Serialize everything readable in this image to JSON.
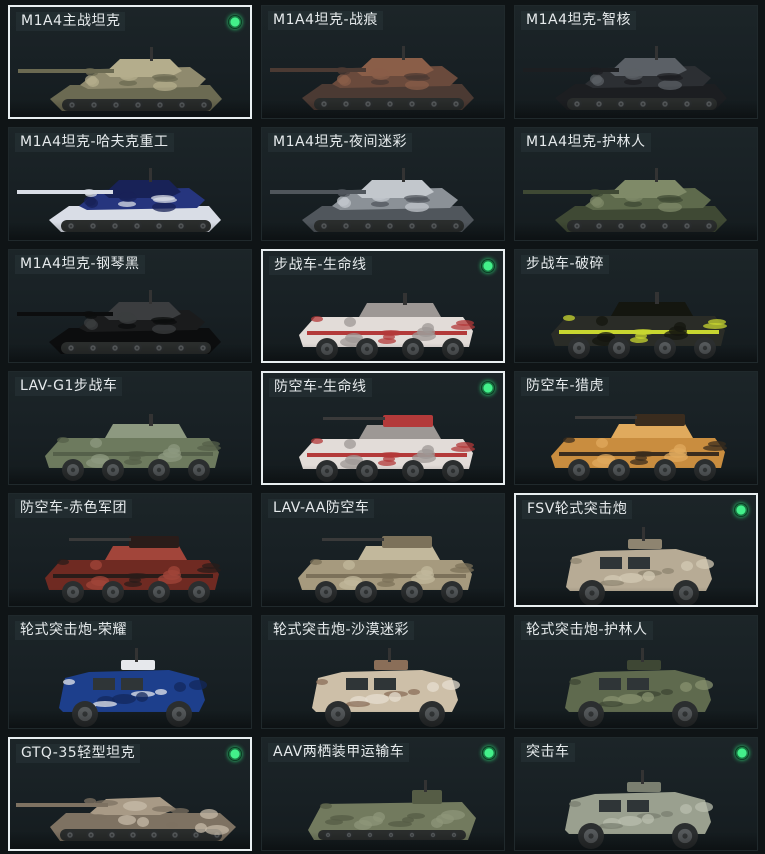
{
  "tiles": [
    {
      "label": "M1A4主战坦克",
      "owned": true,
      "selected": true,
      "kind": "tank",
      "colors": [
        "#8f8a6e",
        "#6b6a52",
        "#b4ad8c"
      ]
    },
    {
      "label": "M1A4坦克-战痕",
      "owned": false,
      "selected": false,
      "kind": "tank",
      "colors": [
        "#6a4a3c",
        "#4b3a33",
        "#8a5e48"
      ]
    },
    {
      "label": "M1A4坦克-智核",
      "owned": false,
      "selected": false,
      "kind": "tank",
      "colors": [
        "#2c2f33",
        "#1c1e21",
        "#5b6066"
      ]
    },
    {
      "label": "M1A4坦克-哈夫克重工",
      "owned": false,
      "selected": false,
      "kind": "tank",
      "colors": [
        "#26357e",
        "#d9dde6",
        "#182257"
      ]
    },
    {
      "label": "M1A4坦克-夜间迷彩",
      "owned": false,
      "selected": false,
      "kind": "tank",
      "colors": [
        "#8b9197",
        "#50565c",
        "#c2c7cc"
      ]
    },
    {
      "label": "M1A4坦克-护林人",
      "owned": false,
      "selected": false,
      "kind": "tank",
      "colors": [
        "#5e6a4c",
        "#3f4934",
        "#7f8a68"
      ]
    },
    {
      "label": "M1A4坦克-钢琴黑",
      "owned": false,
      "selected": false,
      "kind": "tank",
      "colors": [
        "#1a1b1c",
        "#0c0d0e",
        "#3b3d3f"
      ]
    },
    {
      "label": "步战车-生命线",
      "owned": true,
      "selected": true,
      "kind": "apc",
      "colors": [
        "#e2dcd8",
        "#b33a3a",
        "#9d9895"
      ]
    },
    {
      "label": "步战车-破碎",
      "owned": false,
      "selected": false,
      "kind": "apc",
      "colors": [
        "#2a2c27",
        "#c8d630",
        "#14160f"
      ]
    },
    {
      "label": "LAV-G1步战车",
      "owned": false,
      "selected": false,
      "kind": "apc",
      "colors": [
        "#6d7a5e",
        "#55604a",
        "#8d9980"
      ]
    },
    {
      "label": "防空车-生命线",
      "owned": true,
      "selected": true,
      "kind": "aa",
      "colors": [
        "#e2dcd8",
        "#b33a3a",
        "#9d9895"
      ]
    },
    {
      "label": "防空车-猎虎",
      "owned": false,
      "selected": false,
      "kind": "aa",
      "colors": [
        "#c98d3f",
        "#3a2c1e",
        "#e0aa5d"
      ]
    },
    {
      "label": "防空车-赤色军团",
      "owned": false,
      "selected": false,
      "kind": "aa",
      "colors": [
        "#6f2a22",
        "#2a1c19",
        "#a2453a"
      ]
    },
    {
      "label": "LAV-AA防空车",
      "owned": false,
      "selected": false,
      "kind": "aa",
      "colors": [
        "#a69a7e",
        "#7c715a",
        "#c2b89c"
      ]
    },
    {
      "label": "FSV轮式突击炮",
      "owned": true,
      "selected": true,
      "kind": "fsv",
      "colors": [
        "#b7ab95",
        "#8e8470",
        "#d3c9b4"
      ]
    },
    {
      "label": "轮式突击炮-荣耀",
      "owned": false,
      "selected": false,
      "kind": "fsv",
      "colors": [
        "#1d3f8c",
        "#e6e8ec",
        "#13285c"
      ]
    },
    {
      "label": "轮式突击炮-沙漠迷彩",
      "owned": false,
      "selected": false,
      "kind": "fsv",
      "colors": [
        "#cdbfa8",
        "#8a6e58",
        "#e6ddd0"
      ]
    },
    {
      "label": "轮式突击炮-护林人",
      "owned": false,
      "selected": false,
      "kind": "fsv",
      "colors": [
        "#5f6a4e",
        "#3e4734",
        "#87916f"
      ]
    },
    {
      "label": "GTQ-35轻型坦克",
      "owned": true,
      "selected": true,
      "kind": "light",
      "colors": [
        "#a89a86",
        "#7e7262",
        "#c7bba8"
      ]
    },
    {
      "label": "AAV两栖装甲运输车",
      "owned": true,
      "selected": false,
      "kind": "amph",
      "colors": [
        "#727a5e",
        "#555c45",
        "#8e957a"
      ]
    },
    {
      "label": "突击车",
      "owned": true,
      "selected": false,
      "kind": "truck",
      "colors": [
        "#9aa08f",
        "#7a7f70",
        "#b8bdae"
      ]
    }
  ]
}
